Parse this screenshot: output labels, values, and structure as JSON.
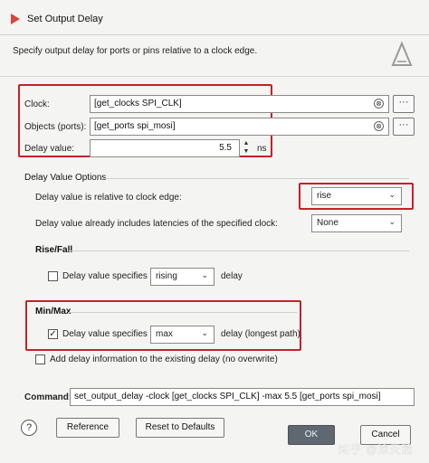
{
  "window": {
    "title": "Set Output Delay"
  },
  "description": "Specify output delay for ports or pins relative to a clock edge.",
  "fields": {
    "clock_label": "Clock:",
    "clock_value": "[get_clocks SPI_CLK]",
    "objects_label": "Objects (ports):",
    "objects_value": "[get_ports spi_mosi]",
    "delay_label": "Delay value:",
    "delay_value": "5.5",
    "delay_unit": "ns"
  },
  "delay_options": {
    "title": "Delay Value Options",
    "relative_label": "Delay value is relative to clock edge:",
    "relative_value": "rise",
    "latency_label": "Delay value already includes latencies of the specified clock:",
    "latency_value": "None"
  },
  "rise_fall": {
    "title": "Rise/Fall",
    "check_label": "Delay value specifies",
    "select_value": "rising",
    "suffix": "delay"
  },
  "min_max": {
    "title": "Min/Max",
    "check_mark": "✓",
    "check_label": "Delay value specifies",
    "select_value": "max",
    "suffix": "delay (longest path)"
  },
  "add_delay": {
    "label": "Add delay information to the existing delay (no overwrite)"
  },
  "command": {
    "label": "Command:",
    "value": "set_output_delay -clock [get_clocks SPI_CLK] -max 5.5 [get_ports spi_mosi]"
  },
  "buttons": {
    "help": "?",
    "reference": "Reference",
    "reset": "Reset to Defaults",
    "ok": "OK",
    "cancel": "Cancel"
  },
  "watermark": "知乎 @滚天猿",
  "icons": {
    "clear": "⊗",
    "more": "···",
    "chevron": "⌄",
    "spin_up": "▲",
    "spin_down": "▼"
  },
  "colors": {
    "highlight": "#c8202a",
    "ok_button": "#5f6870"
  }
}
